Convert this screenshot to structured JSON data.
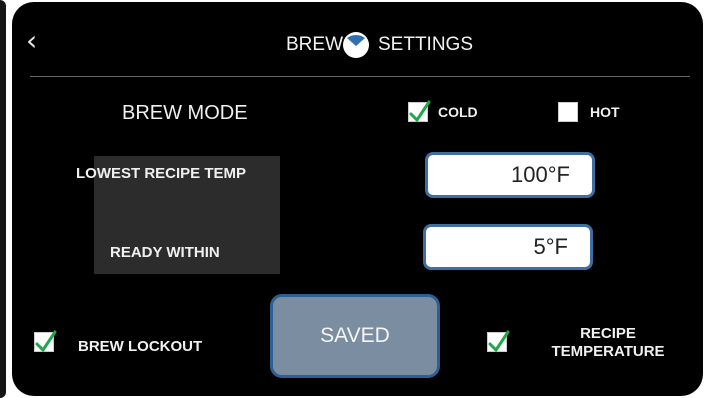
{
  "header": {
    "back_icon": "chevron-left-icon",
    "title_left": "BREW",
    "title_right": "SETTINGS",
    "logo_icon": "brew-logo-icon"
  },
  "brew_mode": {
    "label": "BREW MODE",
    "options": [
      {
        "label": "COLD",
        "checked": true
      },
      {
        "label": "HOT",
        "checked": false
      }
    ]
  },
  "lowest_recipe_temp": {
    "label": "LOWEST RECIPE TEMP",
    "value": "100°F"
  },
  "ready_within": {
    "label": "READY WITHIN",
    "value": "5°F"
  },
  "brew_lockout": {
    "label": "BREW LOCKOUT",
    "checked": true
  },
  "saved_button": {
    "label": "SAVED"
  },
  "recipe_temperature": {
    "label_line1": "RECIPE",
    "label_line2": "TEMPERATURE",
    "checked": true
  },
  "colors": {
    "check": "#1fa84a",
    "field_border": "#3e6fa0",
    "button_fill": "#7b8da0",
    "logo": "#2f6fb0"
  }
}
